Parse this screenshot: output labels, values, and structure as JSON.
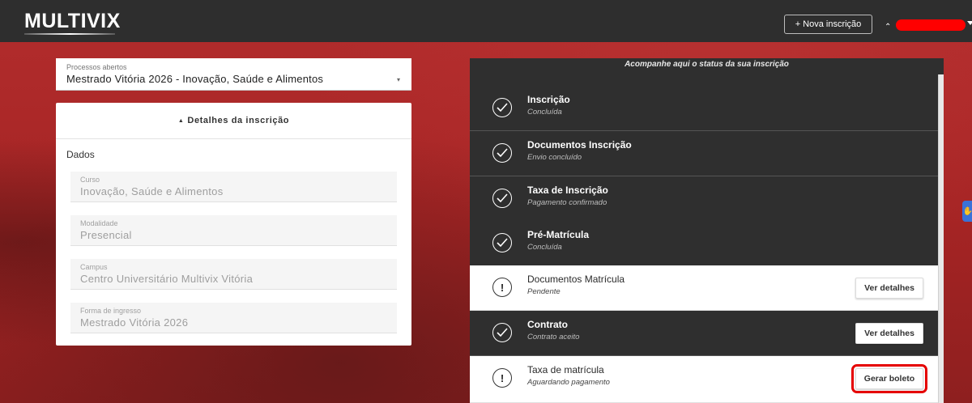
{
  "header": {
    "logo": "MULTIVIX",
    "new_button_icon": "+",
    "new_button_label": "Nova inscrição",
    "user_chevron": "⌃",
    "user_name_redacted_color": "#ff0000"
  },
  "process": {
    "label": "Processos abertos",
    "value": "Mestrado Vitória 2026 - Inovação, Saúde e Alimentos"
  },
  "details": {
    "header": "Detalhes da inscrição",
    "section_title": "Dados",
    "fields": [
      {
        "label": "Curso",
        "value": "Inovação, Saúde e Alimentos"
      },
      {
        "label": "Modalidade",
        "value": "Presencial"
      },
      {
        "label": "Campus",
        "value": "Centro Universitário Multivix Vitória"
      },
      {
        "label": "Forma de ingresso",
        "value": "Mestrado Vitória 2026"
      }
    ]
  },
  "status": {
    "header": "Acompanhe aqui o status da sua inscrição",
    "steps": [
      {
        "title": "Inscrição",
        "subtitle": "Concluída",
        "state": "done",
        "icon": "check-circle-icon"
      },
      {
        "title": "Documentos Inscrição",
        "subtitle": "Envio concluído",
        "state": "done",
        "icon": "check-circle-icon"
      },
      {
        "title": "Taxa de Inscrição",
        "subtitle": "Pagamento confirmado",
        "state": "done",
        "icon": "check-circle-icon"
      },
      {
        "title": "Pré-Matrícula",
        "subtitle": "Concluída",
        "state": "done",
        "icon": "check-circle-icon"
      },
      {
        "title": "Documentos Matrícula",
        "subtitle": "Pendente",
        "state": "pending",
        "icon": "alert-circle-icon",
        "button": "Ver detalhes"
      },
      {
        "title": "Contrato",
        "subtitle": "Contrato aceito",
        "state": "done",
        "icon": "check-circle-icon",
        "button": "Ver detalhes"
      },
      {
        "title": "Taxa de matrícula",
        "subtitle": "Aguardando pagamento",
        "state": "pending",
        "icon": "alert-circle-icon",
        "button": "Gerar boleto"
      }
    ]
  },
  "colors": {
    "topbar": "#2e2e2e",
    "background": "#a82626",
    "panel": "#2f2f2f",
    "highlight": "#e50000"
  }
}
